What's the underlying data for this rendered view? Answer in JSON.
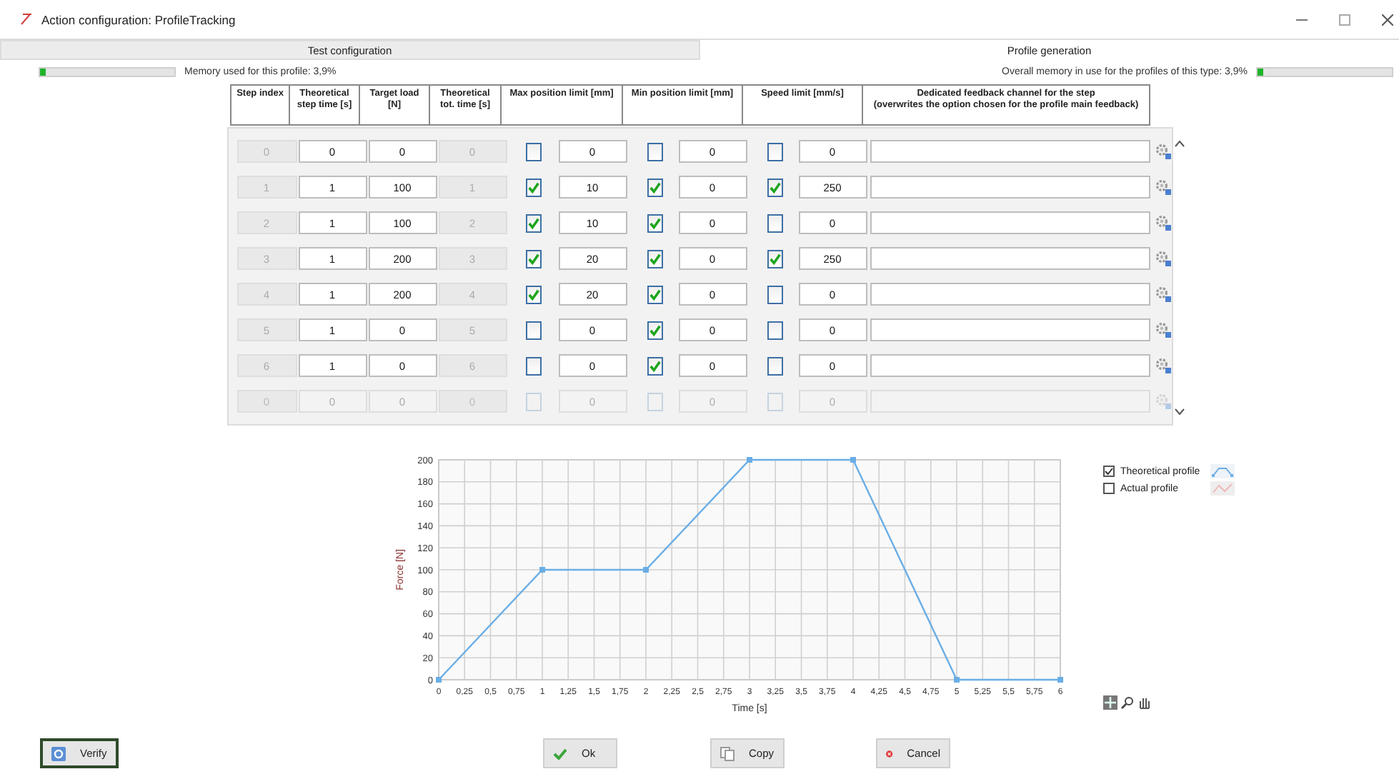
{
  "window": {
    "title": "Action configuration: ProfileTracking"
  },
  "tabs": [
    {
      "label": "Test configuration",
      "selected": false
    },
    {
      "label": "Profile generation",
      "selected": true
    }
  ],
  "memory": {
    "profile": {
      "label": "Memory used for this profile: 3,9%",
      "level": 0.039
    },
    "overall": {
      "label": "Overall memory in use for the profiles of this type: 3,9%",
      "level": 0.039
    }
  },
  "table": {
    "columns": [
      {
        "label": "Step index"
      },
      {
        "label": "Theoretical step time [s]"
      },
      {
        "label": "Target load [N]"
      },
      {
        "label": "Theoretical tot. time [s]"
      },
      {
        "label": "Max position limit [mm]"
      },
      {
        "label": "Min position limit [mm]"
      },
      {
        "label": "Speed limit [mm/s]"
      },
      {
        "label": "Dedicated feedback channel for the step",
        "note": "(overwrites the option chosen for the profile main feedback)"
      }
    ],
    "rows": [
      {
        "index": "0",
        "step_time": "0",
        "target_load": "0",
        "tot_time": "0",
        "max_on": false,
        "max": "0",
        "min_on": false,
        "min": "0",
        "speed_on": false,
        "speed": "0",
        "disabled": false
      },
      {
        "index": "1",
        "step_time": "1",
        "target_load": "100",
        "tot_time": "1",
        "max_on": true,
        "max": "10",
        "min_on": true,
        "min": "0",
        "speed_on": true,
        "speed": "250",
        "disabled": false
      },
      {
        "index": "2",
        "step_time": "1",
        "target_load": "100",
        "tot_time": "2",
        "max_on": true,
        "max": "10",
        "min_on": true,
        "min": "0",
        "speed_on": false,
        "speed": "0",
        "disabled": false
      },
      {
        "index": "3",
        "step_time": "1",
        "target_load": "200",
        "tot_time": "3",
        "max_on": true,
        "max": "20",
        "min_on": true,
        "min": "0",
        "speed_on": true,
        "speed": "250",
        "disabled": false
      },
      {
        "index": "4",
        "step_time": "1",
        "target_load": "200",
        "tot_time": "4",
        "max_on": true,
        "max": "20",
        "min_on": true,
        "min": "0",
        "speed_on": false,
        "speed": "0",
        "disabled": false
      },
      {
        "index": "5",
        "step_time": "1",
        "target_load": "0",
        "tot_time": "5",
        "max_on": false,
        "max": "0",
        "min_on": true,
        "min": "0",
        "speed_on": false,
        "speed": "0",
        "disabled": false
      },
      {
        "index": "6",
        "step_time": "1",
        "target_load": "0",
        "tot_time": "6",
        "max_on": false,
        "max": "0",
        "min_on": true,
        "min": "0",
        "speed_on": false,
        "speed": "0",
        "disabled": false
      },
      {
        "index": "0",
        "step_time": "0",
        "target_load": "0",
        "tot_time": "0",
        "max_on": false,
        "max": "0",
        "min_on": false,
        "min": "0",
        "speed_on": false,
        "speed": "0",
        "disabled": true
      }
    ]
  },
  "chart": {
    "legend": [
      {
        "checked": true
      },
      {
        "checked": false
      }
    ],
    "chart_data": {
      "type": "line",
      "xlabel": "Time [s]",
      "ylabel": "Force [N]",
      "x": [
        0,
        1,
        2,
        3,
        4,
        5,
        6
      ],
      "grid": true,
      "series": [
        {
          "name": "Theoretical profile",
          "color": "#6aaee6",
          "marker": "square",
          "values": [
            0,
            100,
            100,
            200,
            200,
            0,
            0
          ]
        },
        {
          "name": "Actual profile",
          "color": "#f0b8b8",
          "values": [
            null,
            null,
            null,
            null,
            null,
            null,
            null
          ]
        }
      ],
      "xlim": [
        0,
        6
      ],
      "ylim": [
        0,
        200
      ],
      "xticks": [
        0,
        {
          "value": 0.25,
          "label": "0,25"
        },
        {
          "value": 0.5,
          "label": "0,5"
        },
        {
          "value": 0.75,
          "label": "0,75"
        },
        1,
        {
          "value": 1.25,
          "label": "1,25"
        },
        {
          "value": 1.5,
          "label": "1,5"
        },
        {
          "value": 1.75,
          "label": "1,75"
        },
        2,
        {
          "value": 2.25,
          "label": "2,25"
        },
        {
          "value": 2.5,
          "label": "2,5"
        },
        {
          "value": 2.75,
          "label": "2,75"
        },
        3,
        {
          "value": 3.25,
          "label": "3,25"
        },
        {
          "value": 3.5,
          "label": "3,5"
        },
        {
          "value": 3.75,
          "label": "3,75"
        },
        4,
        {
          "value": 4.25,
          "label": "4,25"
        },
        {
          "value": 4.5,
          "label": "4,5"
        },
        {
          "value": 4.75,
          "label": "4,75"
        },
        5,
        {
          "value": 5.25,
          "label": "5,25"
        },
        {
          "value": 5.5,
          "label": "5,5"
        },
        {
          "value": 5.75,
          "label": "5,75"
        },
        6
      ],
      "yticks": [
        0,
        20,
        40,
        60,
        80,
        100,
        120,
        140,
        160,
        180,
        200
      ]
    }
  },
  "buttons": [
    {
      "label": "Verify",
      "kind": "verify",
      "focused": true
    },
    {
      "label": "Ok",
      "kind": "ok",
      "focused": false
    },
    {
      "label": "Copy",
      "kind": "copy",
      "focused": false
    },
    {
      "label": "Cancel",
      "kind": "cancel",
      "focused": false
    }
  ]
}
